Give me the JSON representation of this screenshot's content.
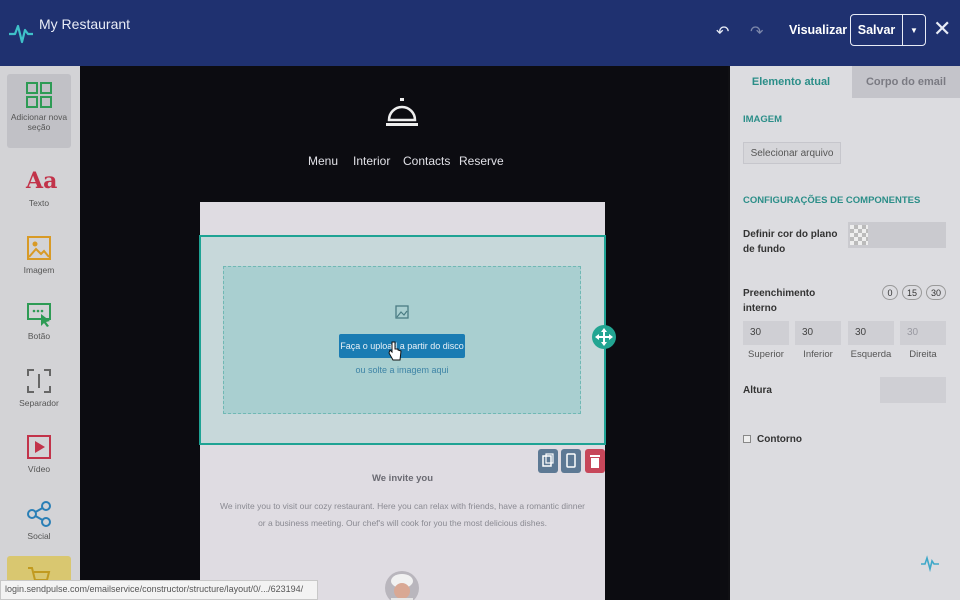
{
  "app": {
    "title": "My Restaurant",
    "preview_label": "Visualizar",
    "save_label": "Salvar"
  },
  "sidebar": {
    "items": [
      {
        "label": "Adicionar nova seção",
        "icon": "grid-icon"
      },
      {
        "label": "Texto",
        "icon": "text-icon"
      },
      {
        "label": "Imagem",
        "icon": "image-icon"
      },
      {
        "label": "Botão",
        "icon": "button-icon"
      },
      {
        "label": "Separador",
        "icon": "separator-icon"
      },
      {
        "label": "Vídeo",
        "icon": "video-icon"
      },
      {
        "label": "Social",
        "icon": "share-icon"
      }
    ]
  },
  "canvas": {
    "nav": [
      "Menu",
      "Interior",
      "Contacts",
      "Reserve"
    ],
    "upload_button": "Faça o upload a partir do disco",
    "drag_text": "ou solte a imagem aqui",
    "invite_title": "We invite you",
    "invite_text": "We invite you to visit our cozy restaurant. Here you can relax with friends, have a romantic dinner or a business meeting. Our chef's will cook for you the most delicious dishes."
  },
  "status_url": "login.sendpulse.com/emailservice/constructor/structure/layout/0/.../623194/",
  "panel": {
    "tabs": [
      "Elemento atual",
      "Corpo do email"
    ],
    "image_heading": "IMAGEM",
    "file_button": "Selecionar arquivo",
    "components_heading": "CONFIGURAÇÕES DE COMPONENTES",
    "bg_color_label": "Definir cor do plano de fundo",
    "padding_label": "Preenchimento interno",
    "padding_presets": [
      "0",
      "15",
      "30"
    ],
    "padding_values": [
      {
        "value": "30",
        "label": "Superior"
      },
      {
        "value": "30",
        "label": "Inferior"
      },
      {
        "value": "30",
        "label": "Esquerda"
      },
      {
        "value": "30",
        "label": "Direita"
      }
    ],
    "height_label": "Altura",
    "border_label": "Contorno"
  },
  "colors": {
    "topbar": "#1f3170",
    "accent": "#2b8e88",
    "upload_button": "#1a7cb3",
    "delete_button": "#c7475a"
  }
}
